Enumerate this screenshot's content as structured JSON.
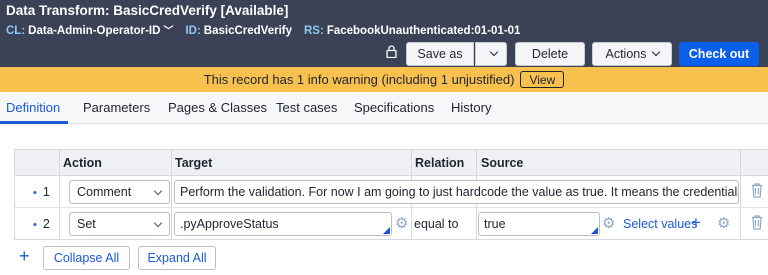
{
  "header": {
    "title": "Data Transform: BasicCredVerify [Available]",
    "class_label": "CL:",
    "class_value": "Data-Admin-Operator-ID",
    "id_label": "ID:",
    "id_value": "BasicCredVerify",
    "rs_label": "RS:",
    "rs_value": "FacebookUnauthenticated:01-01-01"
  },
  "toolbar": {
    "save_as": "Save as",
    "delete": "Delete",
    "actions": "Actions",
    "check_out": "Check out",
    "more": "⋮"
  },
  "warning": {
    "message": "This record has 1 info warning (including 1 unjustified)",
    "view": "View",
    "color": "#f8c14e"
  },
  "tabs": [
    {
      "label": "Definition",
      "active": true
    },
    {
      "label": "Parameters"
    },
    {
      "label": "Pages & Classes"
    },
    {
      "label": "Test cases"
    },
    {
      "label": "Specifications"
    },
    {
      "label": "History"
    }
  ],
  "grid": {
    "columns": [
      "Action",
      "Target",
      "Relation",
      "Source"
    ],
    "rows": [
      {
        "num": "1",
        "action": "Comment",
        "target": "Perform the validation. For now I am going to just hardcode the value as true. It means the credentials a"
      },
      {
        "num": "2",
        "action": "Set",
        "target": ".pyApproveStatus",
        "relation": "equal to",
        "source": "true",
        "select_values": "Select values"
      }
    ]
  },
  "bottom": {
    "collapse_all": "Collapse All",
    "expand_all": "Expand All"
  },
  "colors": {
    "header_bg": "#3b4256",
    "accent": "#1a5ad7",
    "checkout": "#0b5fe8"
  }
}
